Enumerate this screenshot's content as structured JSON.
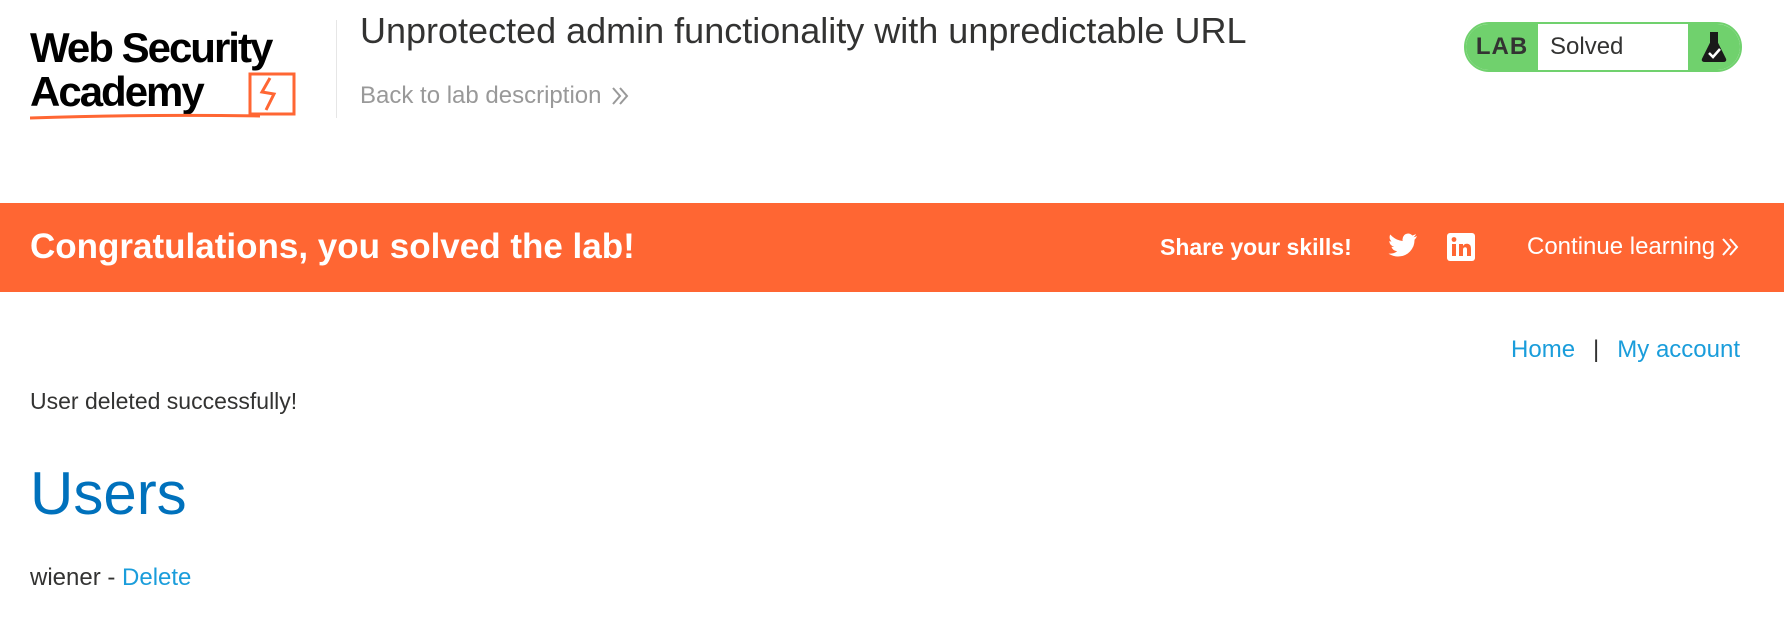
{
  "header": {
    "logo_line1": "Web Security",
    "logo_line2": "Academy",
    "lab_title": "Unprotected admin functionality with unpredictable URL",
    "back_link": "Back to lab description",
    "status": {
      "badge": "LAB",
      "text": "Solved",
      "icon": "flask-check-icon"
    }
  },
  "banner": {
    "message": "Congratulations, you solved the lab!",
    "share_label": "Share your skills!",
    "social_icons": [
      "twitter-icon",
      "linkedin-icon"
    ],
    "continue_label": "Continue learning"
  },
  "nav": {
    "home": "Home",
    "separator": "|",
    "account": "My account"
  },
  "main": {
    "notice": "User deleted successfully!",
    "heading": "Users",
    "users": [
      {
        "name": "wiener",
        "separator": " - ",
        "action": "Delete"
      }
    ]
  },
  "colors": {
    "accent_orange": "#ff6633",
    "solved_green": "#70d16d",
    "link_blue": "#1a9ddb",
    "heading_blue": "#0071bc"
  }
}
